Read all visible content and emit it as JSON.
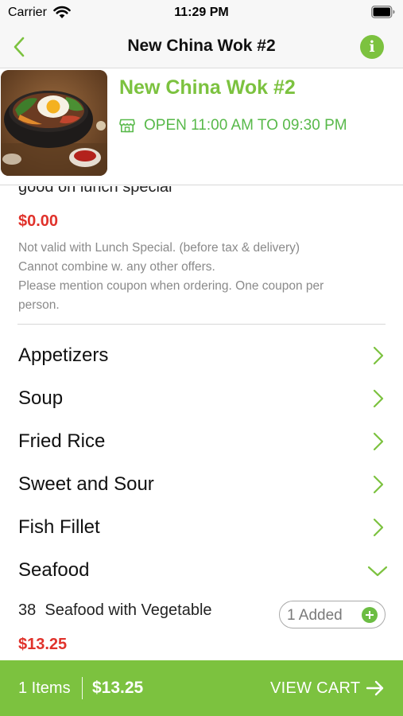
{
  "status_bar": {
    "carrier": "Carrier",
    "time": "11:29 PM"
  },
  "nav": {
    "title": "New China Wok #2",
    "info_icon_glyph": "i"
  },
  "restaurant": {
    "name": "New China Wok #2",
    "hours": "OPEN 11:00 AM TO 09:30 PM"
  },
  "coupon": {
    "title_partial": "good on lunch special",
    "price": "$0.00",
    "note_lines": [
      "Not valid with Lunch Special. (before tax & delivery)",
      "Cannot combine w. any other offers.",
      "Please mention coupon when ordering. One coupon per",
      "person."
    ]
  },
  "categories": [
    {
      "label": "Appetizers",
      "icon": "chevron-right-icon",
      "expanded": false
    },
    {
      "label": "Soup",
      "icon": "chevron-right-icon",
      "expanded": false
    },
    {
      "label": "Fried Rice",
      "icon": "chevron-right-icon",
      "expanded": false
    },
    {
      "label": "Sweet and Sour",
      "icon": "chevron-right-icon",
      "expanded": false
    },
    {
      "label": "Fish Fillet",
      "icon": "chevron-right-icon",
      "expanded": false
    },
    {
      "label": "Seafood",
      "icon": "chevron-down-icon",
      "expanded": true
    }
  ],
  "seafood_item": {
    "name": "38  Seafood with Vegetable",
    "added_label": "1 Added",
    "price": "$13.25"
  },
  "cart": {
    "items_label": "1 Items",
    "total": "$13.25",
    "view_cart_label": "VIEW CART"
  },
  "colors": {
    "brand_green": "#7cc23f",
    "hours_green": "#58b94a",
    "price_red": "#e0322b",
    "muted_gray": "#8a8a8a"
  }
}
